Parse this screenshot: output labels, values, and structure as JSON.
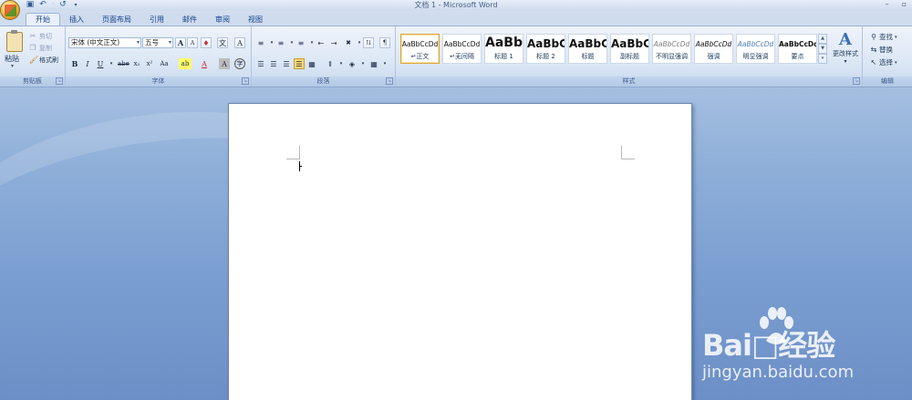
{
  "window": {
    "title": "文档 1 - Microsoft Word",
    "minimize": "–",
    "restore": "▫"
  },
  "qat": [
    "save-icon",
    "undo-icon",
    "redo-icon",
    "customize-icon"
  ],
  "tabs": [
    {
      "label": "开始",
      "active": true
    },
    {
      "label": "插入"
    },
    {
      "label": "页面布局"
    },
    {
      "label": "引用"
    },
    {
      "label": "邮件"
    },
    {
      "label": "审阅"
    },
    {
      "label": "视图"
    }
  ],
  "clipboard": {
    "group_label": "剪贴板",
    "paste": "粘贴",
    "cut": "剪切",
    "copy": "复制",
    "format_painter": "格式刷"
  },
  "font": {
    "group_label": "字体",
    "font_name": "宋体 (中文正文)",
    "font_size": "五号",
    "grow": "A",
    "shrink": "A",
    "clear": "·",
    "phonetic": "文",
    "border_char": "A",
    "bold": "B",
    "italic": "I",
    "underline": "U",
    "strike": "abe",
    "subscript": "x₂",
    "superscript": "x²",
    "change_case": "Aa",
    "highlight": "ab",
    "font_color": "A",
    "char_shading": "A",
    "enclose": "字"
  },
  "paragraph": {
    "group_label": "段落"
  },
  "styles": {
    "group_label": "样式",
    "items": [
      {
        "sample": "AaBbCcDd",
        "name": "↵正文",
        "selected": true
      },
      {
        "sample": "AaBbCcDd",
        "name": "↵无间隔"
      },
      {
        "sample": "AaBb",
        "name": "标题 1"
      },
      {
        "sample": "AaBbC",
        "name": "标题 2"
      },
      {
        "sample": "AaBbC",
        "name": "标题"
      },
      {
        "sample": "AaBbC",
        "name": "副标题"
      },
      {
        "sample": "AaBbCcDd",
        "name": "不明显强调"
      },
      {
        "sample": "AaBbCcDd",
        "name": "强调"
      },
      {
        "sample": "AaBbCcDd",
        "name": "明显强调"
      },
      {
        "sample": "AaBbCcDd",
        "name": "要点"
      }
    ],
    "change_styles": "更改样式"
  },
  "editing": {
    "group_label": "编辑",
    "find": "查找",
    "replace": "替换",
    "select": "选择"
  },
  "watermark": {
    "brand": "Bai□经验",
    "url": "jingyan.baidu.com"
  }
}
